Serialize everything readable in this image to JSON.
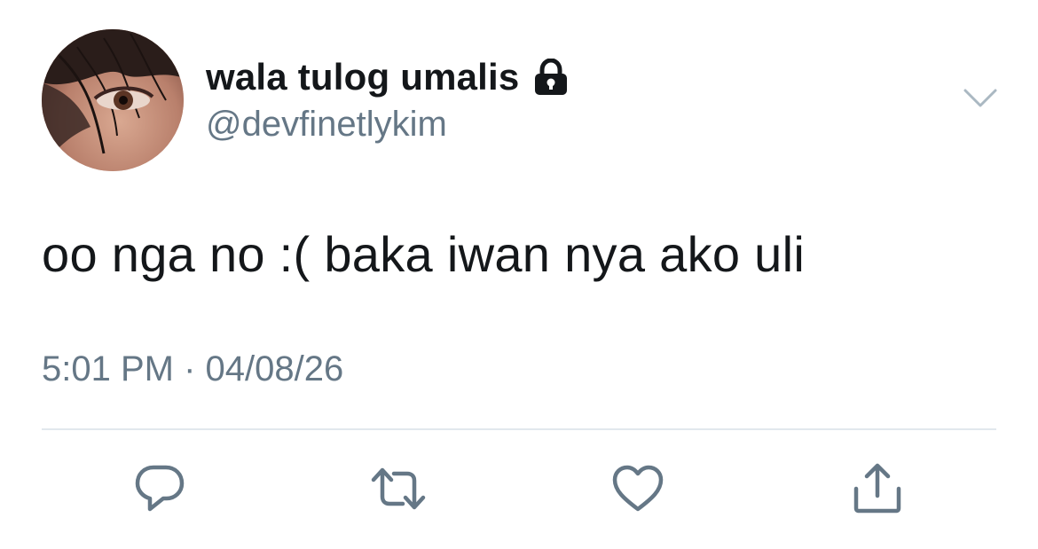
{
  "tweet": {
    "display_name": "wala tulog umalis",
    "handle": "@devfinetlykim",
    "protected_icon": "lock-icon",
    "text": "oo nga no :( baka iwan nya ako uli",
    "timestamp": "5:01 PM · 04/08/26"
  },
  "header": {
    "menu_icon": "chevron-down-icon"
  },
  "actions": [
    {
      "name": "reply",
      "icon": "reply-icon"
    },
    {
      "name": "retweet",
      "icon": "retweet-icon"
    },
    {
      "name": "like",
      "icon": "heart-icon"
    },
    {
      "name": "share",
      "icon": "share-icon"
    }
  ],
  "colors": {
    "text_primary": "#14171a",
    "text_secondary": "#657786",
    "divider": "#e1e8ed",
    "icon": "#657786"
  }
}
